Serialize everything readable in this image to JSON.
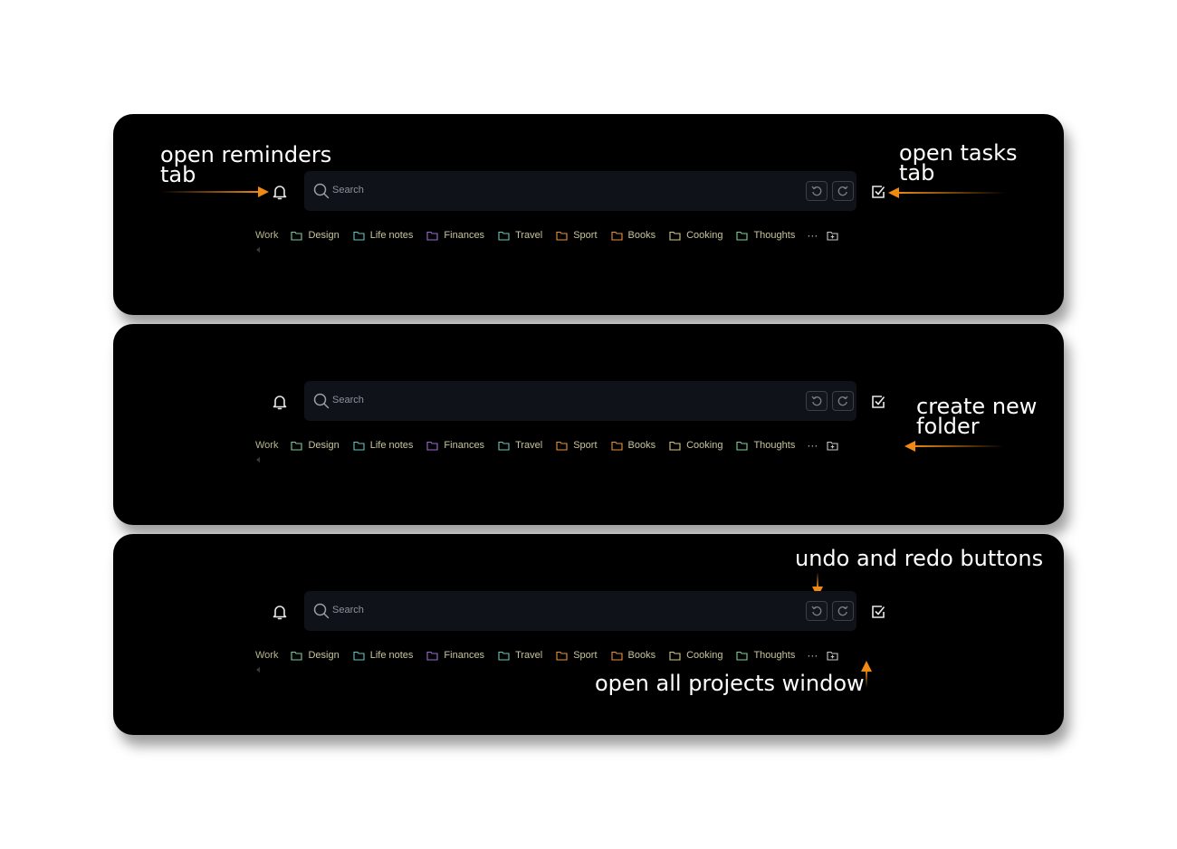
{
  "toolbar": {
    "search_placeholder": "Search",
    "work_label": "Work",
    "folders": [
      {
        "label": "Design",
        "color": "#7fc9a0"
      },
      {
        "label": "Life notes",
        "color": "#63c6c0"
      },
      {
        "label": "Finances",
        "color": "#9b6ad2"
      },
      {
        "label": "Travel",
        "color": "#6cc4b5"
      },
      {
        "label": "Sport",
        "color": "#e8923a"
      },
      {
        "label": "Books",
        "color": "#e8923a"
      },
      {
        "label": "Cooking",
        "color": "#d5c98a"
      },
      {
        "label": "Thoughts",
        "color": "#7fcf9a"
      }
    ],
    "more_label": "···"
  },
  "annotations": {
    "reminders_line1": "open reminders",
    "reminders_line2": "tab",
    "tasks_line1": "open tasks",
    "tasks_line2": "tab",
    "folder_line1": "create new",
    "folder_line2": "folder",
    "undo_redo": "undo and redo buttons",
    "projects": "open all projects window"
  },
  "colors": {
    "accent_arrow": "#f08a12",
    "panel_bg": "#000000",
    "search_bg": "#10121a"
  }
}
